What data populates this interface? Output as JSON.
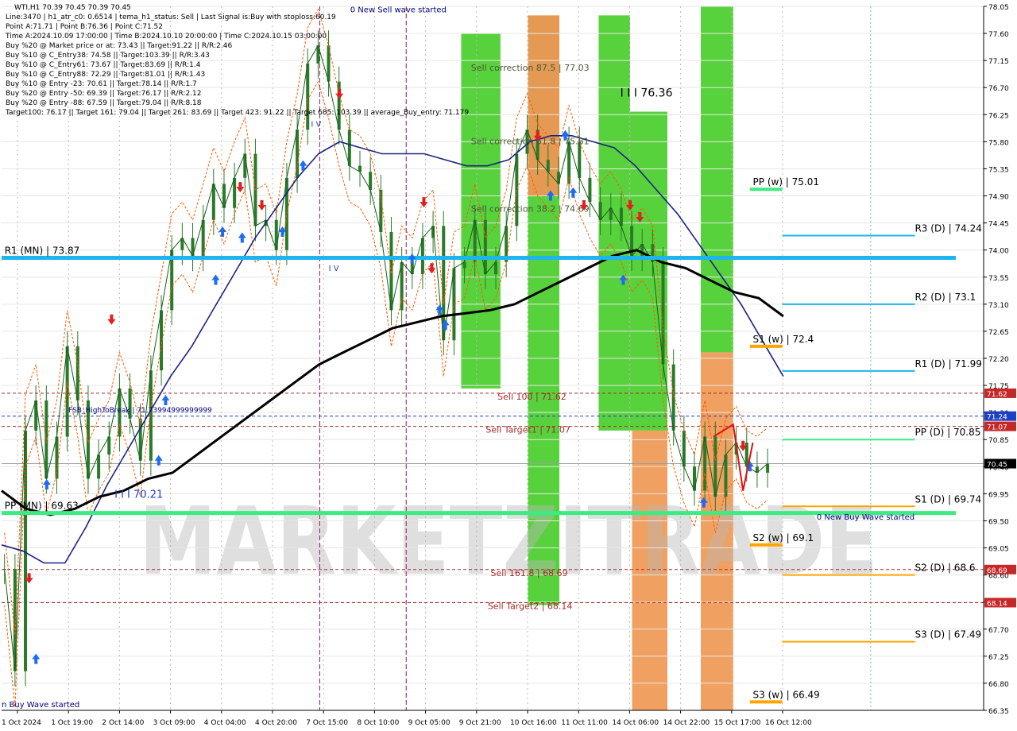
{
  "header": {
    "symbol_line": "WTI,H1  70.39 70.45 70.39 70.45",
    "info_lines": [
      "Line:3470  |  h1_atr_c0: 0.6514  |  tema_h1_status: Sell  |  Last Signal is:Buy with stoploss:60.19",
      "Point A:71.71  |  Point B:76.36  |  Point C:71.52",
      "Time A:2024.10.09 17:00:00  |  Time B:2024.10.10 20:00:00  |  Time C:2024.10.15 03:00:00",
      "Buy %20 @ Market price or at: 73.43  ||  Target:91.22  ||  R/R:2.46",
      "Buy %10 @ C_Entry38: 74.58  ||  Target:103.39  ||  R/R:3.43",
      "Buy %10 @ C_Entry61: 73.67  ||  Target:83.69  ||  R/R:1.4",
      "Buy %10 @ C_Entry88: 72.29  ||  Target:81.01  ||  R/R:1.43",
      "Buy %10 @ Entry -23: 70.61  ||  Target:78.14  ||  R/R:1.7",
      "Buy %20 @ Entry -50: 69.39  ||  Target:76.17  ||  R/R:2.12",
      "Buy %20 @ Entry -88: 67.59  ||  Target:79.04  ||  R/R:8.18",
      "Target100: 76.17  ||  Target 161: 79.04  ||  Target 261: 83.69  ||  Target 423: 91.22  ||  Target 685: 103.39  ||  average_Buy_entry: 71.179"
    ]
  },
  "watermark": "MARKETZITRADE",
  "chart_data": {
    "type": "line",
    "title": "WTI,H1",
    "ylim": [
      66.35,
      78.05
    ],
    "y_ticks": [
      "78.05",
      "77.60",
      "77.15",
      "76.70",
      "76.25",
      "75.80",
      "75.35",
      "74.90",
      "74.45",
      "74.00",
      "73.55",
      "73.10",
      "72.65",
      "72.20",
      "71.75",
      "71.30",
      "70.85",
      "70.40",
      "69.95",
      "69.50",
      "69.05",
      "68.60",
      "68.15",
      "67.70",
      "67.25",
      "66.80",
      "66.35"
    ],
    "x_ticks": [
      "1 Oct 2024",
      "1 Oct 19:00",
      "2 Oct 14:00",
      "3 Oct 09:00",
      "4 Oct 04:00",
      "4 Oct 20:00",
      "7 Oct 15:00",
      "8 Oct 10:00",
      "9 Oct 05:00",
      "9 Oct 21:00",
      "10 Oct 16:00",
      "11 Oct 11:00",
      "14 Oct 06:00",
      "14 Oct 22:00",
      "15 Oct 17:00",
      "16 Oct 12:00"
    ],
    "current_price": {
      "value": 70.45,
      "label": "70.45"
    },
    "price_tags": [
      {
        "value": 71.62,
        "label": "71.62",
        "color": "#c62828"
      },
      {
        "value": 71.24,
        "label": "71.24",
        "color": "#1e40c8"
      },
      {
        "value": 71.07,
        "label": "71.07",
        "color": "#c62828"
      },
      {
        "value": 68.69,
        "label": "68.69",
        "color": "#c62828"
      },
      {
        "value": 68.14,
        "label": "68.14",
        "color": "#c62828"
      }
    ],
    "dashed_lines": [
      {
        "value": 71.62,
        "color": "#a52a2a"
      },
      {
        "value": 71.24,
        "color": "#1e40c8"
      },
      {
        "value": 71.07,
        "color": "#a52a2a"
      },
      {
        "value": 68.69,
        "color": "#a52a2a"
      },
      {
        "value": 68.14,
        "color": "#a52a2a"
      }
    ],
    "levels": [
      {
        "label": "R1 (MN) | 73.87",
        "value": 73.87,
        "color": "#1eb4f0",
        "width": 5,
        "x0_frac": 0.0,
        "label_x_frac": 0.003
      },
      {
        "label": "PP (MN) | 69.63",
        "value": 69.63,
        "color": "#3ceb82",
        "width": 5,
        "x0_frac": 0.0,
        "label_x_frac": 0.003
      },
      {
        "label": "PP (w) | 75.01",
        "value": 75.01,
        "color": "#3ceb82",
        "width": 4,
        "x0_frac": 0.762,
        "label_x_frac": 0.765
      },
      {
        "label": "S1 (w) | 72.4",
        "value": 72.4,
        "color": "#ffa500",
        "width": 4,
        "x0_frac": 0.762,
        "label_x_frac": 0.765
      },
      {
        "label": "S2 (w) | 69.1",
        "value": 69.1,
        "color": "#ffa500",
        "width": 4,
        "x0_frac": 0.762,
        "label_x_frac": 0.765
      },
      {
        "label": "S3 (w) | 66.49",
        "value": 66.49,
        "color": "#ffa500",
        "width": 4,
        "x0_frac": 0.762,
        "label_x_frac": 0.765
      },
      {
        "label": "R3 (D) | 74.24",
        "value": 74.24,
        "color": "#1eb4f0",
        "width": 2,
        "x0_frac": 0.93,
        "label_x_frac": 0.93
      },
      {
        "label": "R2 (D) | 73.1",
        "value": 73.1,
        "color": "#1eb4f0",
        "width": 2,
        "x0_frac": 0.93,
        "label_x_frac": 0.93
      },
      {
        "label": "R1 (D) | 71.99",
        "value": 71.99,
        "color": "#1eb4f0",
        "width": 2,
        "x0_frac": 0.93,
        "label_x_frac": 0.93
      },
      {
        "label": "PP (D) | 70.85",
        "value": 70.85,
        "color": "#3ceb82",
        "width": 2,
        "x0_frac": 0.93,
        "label_x_frac": 0.93
      },
      {
        "label": "S1 (D) | 69.74",
        "value": 69.74,
        "color": "#ffa500",
        "width": 2,
        "x0_frac": 0.93,
        "label_x_frac": 0.93
      },
      {
        "label": "S2 (D) | 68.6",
        "value": 68.6,
        "color": "#ffa500",
        "width": 2,
        "x0_frac": 0.93,
        "label_x_frac": 0.93
      },
      {
        "label": "S3 (D) | 67.49",
        "value": 67.49,
        "color": "#ffa500",
        "width": 2,
        "x0_frac": 0.93,
        "label_x_frac": 0.93
      }
    ],
    "zone_bands": [
      {
        "x0_frac": 0.468,
        "x1_frac": 0.508,
        "top": 77.6,
        "bottom": 71.7,
        "color": "#58d23c"
      },
      {
        "x0_frac": 0.536,
        "x1_frac": 0.568,
        "top": 77.9,
        "bottom": 74.9,
        "color": "#e49a52"
      },
      {
        "x0_frac": 0.536,
        "x1_frac": 0.568,
        "top": 74.9,
        "bottom": 68.1,
        "color": "#58d23c"
      },
      {
        "x0_frac": 0.608,
        "x1_frac": 0.64,
        "top": 77.9,
        "bottom": 71.0,
        "color": "#58d23c"
      },
      {
        "x0_frac": 0.64,
        "x1_frac": 0.678,
        "top": 76.3,
        "bottom": 71.0,
        "color": "#58d23c"
      },
      {
        "x0_frac": 0.642,
        "x1_frac": 0.678,
        "top": 71.0,
        "bottom": 66.35,
        "color": "#f0a060"
      },
      {
        "x0_frac": 0.712,
        "x1_frac": 0.745,
        "top": 78.05,
        "bottom": 72.3,
        "color": "#58d23c"
      },
      {
        "x0_frac": 0.712,
        "x1_frac": 0.745,
        "top": 72.3,
        "bottom": 66.35,
        "color": "#f0a060"
      }
    ],
    "fib_labels": [
      {
        "text": "Sell correction 87.5 | 77.03",
        "value": 77.03,
        "x_frac": 0.478,
        "color": "#4a5a3a"
      },
      {
        "text": "Sell correction 61.8 | 75.81",
        "value": 75.81,
        "x_frac": 0.478,
        "color": "#4a5a3a"
      },
      {
        "text": "Sell correction 38.2 | 74.69",
        "value": 74.69,
        "x_frac": 0.478,
        "color": "#4a5a3a"
      },
      {
        "text": "Sell 100 | 71.62",
        "value": 71.62,
        "x_frac": 0.505,
        "color": "#a52a2a"
      },
      {
        "text": "Sell Target1 | 71.07",
        "value": 71.07,
        "x_frac": 0.493,
        "color": "#a52a2a"
      },
      {
        "text": "Sell 161.8 | 68.69",
        "value": 68.69,
        "x_frac": 0.498,
        "color": "#a52a2a"
      },
      {
        "text": "Sell Target2 | 68.14",
        "value": 68.14,
        "x_frac": 0.495,
        "color": "#a52a2a"
      }
    ],
    "annotations": [
      {
        "text": "0 New Sell wave started",
        "value": 77.95,
        "x_frac": 0.355,
        "color": "#000080",
        "size": 10
      },
      {
        "text": "I I I 76.36",
        "value": 76.55,
        "x_frac": 0.63,
        "color": "#000000",
        "size": 14
      },
      {
        "text": "0 New Buy Wave started",
        "value": 69.52,
        "x_frac": 0.83,
        "color": "#000080",
        "size": 10
      },
      {
        "text": "I V",
        "value": 73.65,
        "x_frac": 0.333,
        "color": "#1e40c8",
        "size": 10
      },
      {
        "text": "I V",
        "value": 76.05,
        "x_frac": 0.315,
        "color": "#1e40c8",
        "size": 10
      },
      {
        "text": "I I I 70.21",
        "value": 69.88,
        "x_frac": 0.115,
        "color": "#1e40c8",
        "size": 13
      },
      {
        "text": "FSB_HighToBreak | 71.73994999999999",
        "value": 71.3,
        "x_frac": 0.068,
        "color": "#000080",
        "size": 9
      },
      {
        "text": "n Buy Wave started",
        "value": 66.4,
        "x_frac": 0.0,
        "color": "#000080",
        "size": 10
      }
    ],
    "vlines_magenta": [
      0.324,
      0.412
    ],
    "vlines_gray": [
      0.885
    ],
    "series": [
      {
        "name": "price",
        "values": [
          68.7,
          67.0,
          71.0,
          71.5,
          70.2,
          70.9,
          72.4,
          71.5,
          70.2,
          70.6,
          70.9,
          71.7,
          71.2,
          70.5,
          72.0,
          73.0,
          74.0,
          74.2,
          73.9,
          74.5,
          75.1,
          74.7,
          75.2,
          75.6,
          74.4,
          74.5,
          74.0,
          75.2,
          76.0,
          77.1,
          77.4,
          76.8,
          76.0,
          75.4,
          75.3,
          75.0,
          74.3,
          73.0,
          73.8,
          73.6,
          74.2,
          74.4,
          72.5,
          73.7,
          73.8,
          74.5,
          73.6,
          73.8,
          74.4,
          75.6,
          76.0,
          75.5,
          75.3,
          75.1,
          75.8,
          75.2,
          74.8,
          74.5,
          74.7,
          74.4,
          73.9,
          74.1,
          73.8,
          72.1,
          71.0,
          70.4,
          70.0,
          70.9,
          69.9,
          70.6,
          70.8,
          70.4,
          70.3,
          70.45
        ]
      },
      {
        "name": "fast_ma",
        "values": [
          69.1,
          69.0,
          68.8,
          68.8,
          69.4,
          70.1,
          70.7,
          71.3,
          71.9,
          72.4,
          73.0,
          73.6,
          74.2,
          74.7,
          75.2,
          75.6,
          75.8,
          75.7,
          75.6,
          75.6,
          75.6,
          75.5,
          75.4,
          75.4,
          75.5,
          75.8,
          75.9,
          75.9,
          75.8,
          75.7,
          75.4,
          75.0,
          74.6,
          74.1,
          73.6,
          73.1,
          72.5,
          71.9
        ]
      },
      {
        "name": "slow_ma",
        "values": [
          70.0,
          69.7,
          69.6,
          69.7,
          69.9,
          70.0,
          70.2,
          70.3,
          70.6,
          70.9,
          71.2,
          71.5,
          71.8,
          72.1,
          72.3,
          72.5,
          72.7,
          72.8,
          72.9,
          72.95,
          73.0,
          73.1,
          73.3,
          73.5,
          73.7,
          73.9,
          74.0,
          73.8,
          73.7,
          73.5,
          73.3,
          73.2,
          72.9
        ]
      }
    ],
    "arrows": [
      {
        "x_frac": 0.028,
        "value": 68.55,
        "dir": "down",
        "color": "#e02020"
      },
      {
        "x_frac": 0.035,
        "value": 67.2,
        "dir": "up",
        "color": "#1e6cf0"
      },
      {
        "x_frac": 0.046,
        "value": 70.1,
        "dir": "up",
        "color": "#1e6cf0"
      },
      {
        "x_frac": 0.112,
        "value": 72.85,
        "dir": "down",
        "color": "#e02020"
      },
      {
        "x_frac": 0.16,
        "value": 70.5,
        "dir": "up",
        "color": "#1e6cf0"
      },
      {
        "x_frac": 0.167,
        "value": 71.5,
        "dir": "up",
        "color": "#1e6cf0"
      },
      {
        "x_frac": 0.218,
        "value": 73.5,
        "dir": "up",
        "color": "#1e6cf0"
      },
      {
        "x_frac": 0.225,
        "value": 74.3,
        "dir": "up",
        "color": "#1e6cf0"
      },
      {
        "x_frac": 0.243,
        "value": 75.05,
        "dir": "down",
        "color": "#e02020"
      },
      {
        "x_frac": 0.245,
        "value": 74.2,
        "dir": "up",
        "color": "#1e6cf0"
      },
      {
        "x_frac": 0.265,
        "value": 74.75,
        "dir": "down",
        "color": "#e02020"
      },
      {
        "x_frac": 0.286,
        "value": 74.3,
        "dir": "up",
        "color": "#1e6cf0"
      },
      {
        "x_frac": 0.307,
        "value": 75.4,
        "dir": "up",
        "color": "#1e6cf0"
      },
      {
        "x_frac": 0.344,
        "value": 76.6,
        "dir": "down",
        "color": "#e02020"
      },
      {
        "x_frac": 0.418,
        "value": 73.85,
        "dir": "up",
        "color": "#1e6cf0"
      },
      {
        "x_frac": 0.43,
        "value": 74.8,
        "dir": "down",
        "color": "#e02020"
      },
      {
        "x_frac": 0.438,
        "value": 73.7,
        "dir": "down",
        "color": "#e02020"
      },
      {
        "x_frac": 0.446,
        "value": 73.0,
        "dir": "up",
        "color": "#1e6cf0"
      },
      {
        "x_frac": 0.452,
        "value": 72.75,
        "dir": "up",
        "color": "#1e6cf0"
      },
      {
        "x_frac": 0.546,
        "value": 75.9,
        "dir": "down",
        "color": "#e02020"
      },
      {
        "x_frac": 0.559,
        "value": 74.9,
        "dir": "up",
        "color": "#1e6cf0"
      },
      {
        "x_frac": 0.574,
        "value": 75.9,
        "dir": "up",
        "color": "#1e6cf0"
      },
      {
        "x_frac": 0.582,
        "value": 74.95,
        "dir": "up",
        "color": "#1e6cf0"
      },
      {
        "x_frac": 0.593,
        "value": 74.75,
        "dir": "down",
        "color": "#e02020"
      },
      {
        "x_frac": 0.633,
        "value": 73.5,
        "dir": "up",
        "color": "#1e6cf0"
      },
      {
        "x_frac": 0.64,
        "value": 74.75,
        "dir": "down",
        "color": "#e02020"
      },
      {
        "x_frac": 0.65,
        "value": 74.55,
        "dir": "down",
        "color": "#e02020"
      },
      {
        "x_frac": 0.715,
        "value": 69.8,
        "dir": "up",
        "color": "#1e6cf0"
      },
      {
        "x_frac": 0.755,
        "value": 70.75,
        "dir": "down",
        "color": "#e02020"
      },
      {
        "x_frac": 0.762,
        "value": 70.4,
        "dir": "up",
        "color": "#1e6cf0"
      }
    ],
    "grid": true,
    "legend": "none"
  }
}
